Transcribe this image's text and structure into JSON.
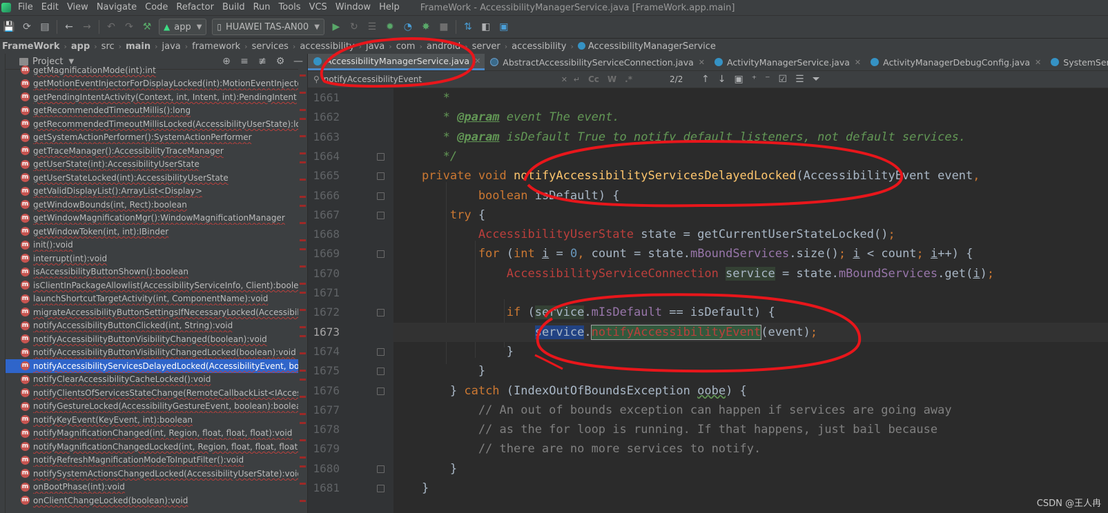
{
  "menu": {
    "items": [
      "File",
      "Edit",
      "View",
      "Navigate",
      "Code",
      "Refactor",
      "Build",
      "Run",
      "Tools",
      "VCS",
      "Window",
      "Help"
    ],
    "window_title": "FrameWork - AccessibilityManagerService.java [FrameWork.app.main]"
  },
  "toolbar": {
    "module": "app",
    "device": "HUAWEI TAS-AN00"
  },
  "breadcrumb": [
    "FrameWork",
    "app",
    "src",
    "main",
    "java",
    "framework",
    "services",
    "accessibility",
    "java",
    "com",
    "android",
    "server",
    "accessibility",
    "AccessibilityManagerService"
  ],
  "project": {
    "title": "Project",
    "badge": "m",
    "items": [
      "getMagnificationMode(int):int",
      "getMotionEventInjectorForDisplayLocked(int):MotionEventInjector",
      "getPendingIntentActivity(Context, int, Intent, int):PendingIntent",
      "getRecommendedTimeoutMillis():long",
      "getRecommendedTimeoutMillisLocked(AccessibilityUserState):long",
      "getSystemActionPerformer():SystemActionPerformer",
      "getTraceManager():AccessibilityTraceManager",
      "getUserState(int):AccessibilityUserState",
      "getUserStateLocked(int):AccessibilityUserState",
      "getValidDisplayList():ArrayList<Display>",
      "getWindowBounds(int, Rect):boolean",
      "getWindowMagnificationMgr():WindowMagnificationManager",
      "getWindowToken(int, int):IBinder",
      "init():void",
      "interrupt(int):void",
      "isAccessibilityButtonShown():boolean",
      "isClientInPackageAllowlist(AccessibilityServiceInfo, Client):boolean",
      "launchShortcutTargetActivity(int, ComponentName):void",
      "migrateAccessibilityButtonSettingsIfNecessaryLocked(AccessibilityUserState",
      "notifyAccessibilityButtonClicked(int, String):void",
      "notifyAccessibilityButtonVisibilityChanged(boolean):void",
      "notifyAccessibilityButtonVisibilityChangedLocked(boolean):void",
      "notifyAccessibilityServicesDelayedLocked(AccessibilityEvent, boolean):void",
      "notifyClearAccessibilityCacheLocked():void",
      "notifyClientsOfServicesStateChange(RemoteCallbackList<IAccessibilityManager",
      "notifyGestureLocked(AccessibilityGestureEvent, boolean):boolean",
      "notifyKeyEvent(KeyEvent, int):boolean",
      "notifyMagnificationChanged(int, Region, float, float, float):void",
      "notifyMagnificationChangedLocked(int, Region, float, float, float):void",
      "notifyRefreshMagnificationModeToInputFilter():void",
      "notifySystemActionsChangedLocked(AccessibilityUserState):void",
      "onBootPhase(int):void",
      "onClientChangeLocked(boolean):void"
    ],
    "selected_index": 22
  },
  "tabs": [
    "AccessibilityManagerService.java",
    "AbstractAccessibilityServiceConnection.java",
    "ActivityManagerService.java",
    "ActivityManagerDebugConfig.java",
    "SystemServer.java"
  ],
  "find": {
    "query": "notifyAccessibilityEvent",
    "count": "2/2",
    "opt_case": "Cc",
    "opt_word": "W",
    "opt_regex": ".*"
  },
  "editor": {
    "current_line": 1673,
    "line_numbers": [
      "1661",
      "1662",
      "1663",
      "1664",
      "1665",
      "1666",
      "1667",
      "1668",
      "1669",
      "1670",
      "1671",
      "1672",
      "1673",
      "1674",
      "1675",
      "1676",
      "1677",
      "1678",
      "1679",
      "1680",
      "1681"
    ]
  },
  "watermark": "CSDN @王人冉",
  "colors": {
    "accent": "#4a88c7",
    "selection": "#2f65ca",
    "annotation": "#e8161b"
  }
}
